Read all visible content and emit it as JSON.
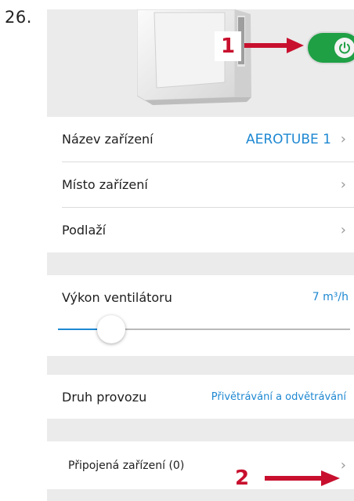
{
  "figure": {
    "step_number": "26."
  },
  "header": {
    "power_icon": "power-icon",
    "power_on": true,
    "accent_color": "#1fa045"
  },
  "callouts": {
    "one": "1",
    "two": "2",
    "color": "#c8102e"
  },
  "device_info": {
    "name_label": "Název zařízení",
    "name_value": "AEROTUBE 1",
    "location_label": "Místo zařízení",
    "floor_label": "Podlaží"
  },
  "fan": {
    "label": "Výkon ventilátoru",
    "value": "7 m³/h",
    "slider_fraction": 0.2
  },
  "mode": {
    "label": "Druh provozu",
    "value": "Přivětrávání a odvětrávání"
  },
  "connected": {
    "label": "Připojená zařízení (0)"
  },
  "colors": {
    "link": "#1e88d2",
    "background": "#ebebeb"
  }
}
